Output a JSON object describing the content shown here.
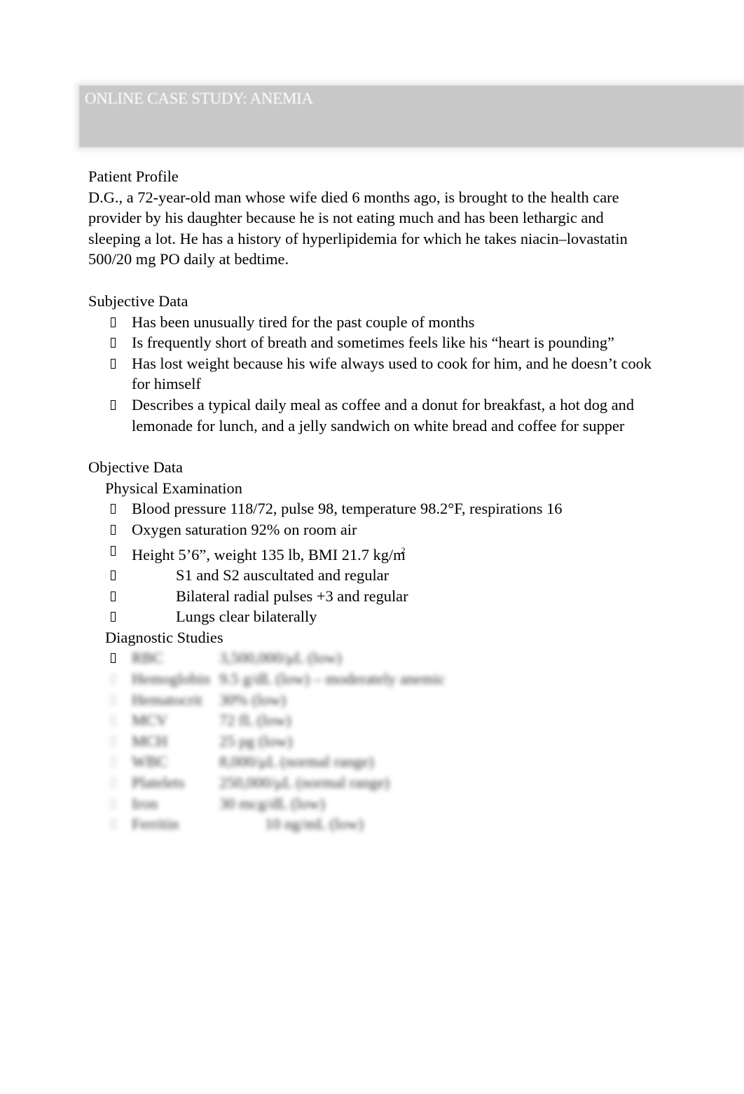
{
  "banner_title": "ONLINE CASE STUDY: ANEMIA",
  "profile": {
    "heading": "Patient Profile",
    "text": "D.G., a 72-year-old man whose wife died 6 months ago, is brought to the health care provider by his daughter because he is not eating much and has been lethargic and sleeping a lot. He has a history of hyperlipidemia for which he takes niacin–lovastatin 500/20 mg PO daily at bedtime."
  },
  "subjective": {
    "heading": "Subjective Data",
    "items": [
      "Has been unusually tired for the past couple of months",
      "Is frequently short of breath and sometimes feels like his “heart is pounding”",
      "Has lost weight because his wife always used to cook for him, and he doesn’t cook for himself",
      "Describes a typical daily meal as coffee and a donut for breakfast, a hot dog and lemonade for lunch, and a jelly sandwich on white bread and coffee for supper"
    ]
  },
  "objective": {
    "heading": "Objective Data",
    "physical_heading": "Physical Examination",
    "physical": [
      "Blood pressure 118/72, pulse 98, temperature 98.2°F, respirations 16",
      "Oxygen saturation 92% on room air",
      "Height 5’6”, weight 135 lb, BMI 21.7 kg/m",
      "S1 and S2 auscultated and regular",
      "Bilateral radial pulses +3 and regular",
      "Lungs clear bilaterally"
    ],
    "bmi_sup": "2",
    "diagnostic_heading": "Diagnostic Studies",
    "diagnostic": [
      {
        "label": "RBC",
        "value": "3,500,000/μL (low)"
      },
      {
        "label": "Hemoglobin",
        "value": "9.5 g/dL (low) – moderately anemic"
      },
      {
        "label": "Hematocrit",
        "value": "30% (low)"
      },
      {
        "label": "MCV",
        "value": "72 fL (low)"
      },
      {
        "label": "MCH",
        "value": "25 pg (low)"
      },
      {
        "label": "WBC",
        "value": "8,000/μL (normal range)"
      },
      {
        "label": "Platelets",
        "value": "250,000/μL (normal range)"
      },
      {
        "label": "Iron",
        "value": "30 mcg/dL (low)"
      },
      {
        "label": "Ferritin",
        "value": "10 ng/mL (low)"
      }
    ]
  }
}
